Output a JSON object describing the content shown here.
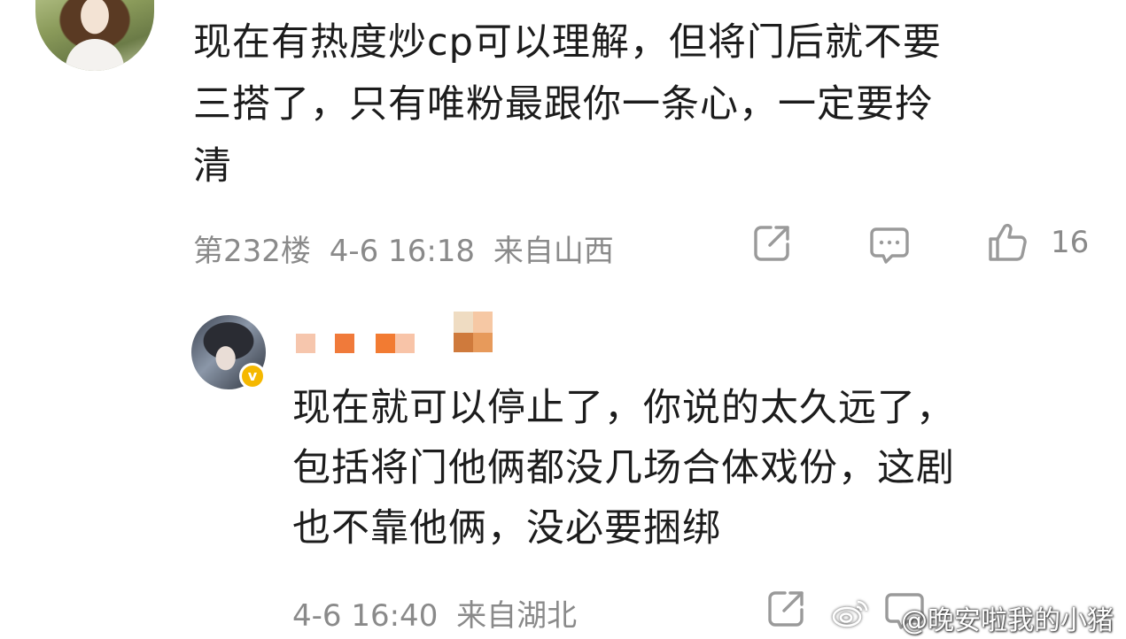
{
  "comment": {
    "lines": [
      "现在有热度炒cp可以理解，但将门后就不要",
      "三搭了，只有唯粉最跟你一条心，一定要拎",
      "清"
    ],
    "floor": "第232楼",
    "time": "4-6 16:18",
    "location": "来自山西",
    "like_count": "16"
  },
  "reply": {
    "lines": [
      "现在就可以停止了，你说的太久远了，",
      "包括将门他俩都没几场合体戏份，这剧",
      "也不靠他俩，没必要捆绑"
    ],
    "time": "4-6 16:40",
    "location": "来自湖北",
    "verified_mark": "v"
  },
  "watermark": "@晚安啦我的小猪",
  "icons": {
    "share": "share-icon",
    "comment": "comment-icon",
    "like": "like-icon",
    "verified": "verified-badge-icon",
    "weibo": "weibo-logo-icon"
  },
  "colors": {
    "text": "#1c1c1c",
    "meta": "#8a8a8a",
    "icon": "#9a9a9a",
    "verified": "#f5b800"
  }
}
